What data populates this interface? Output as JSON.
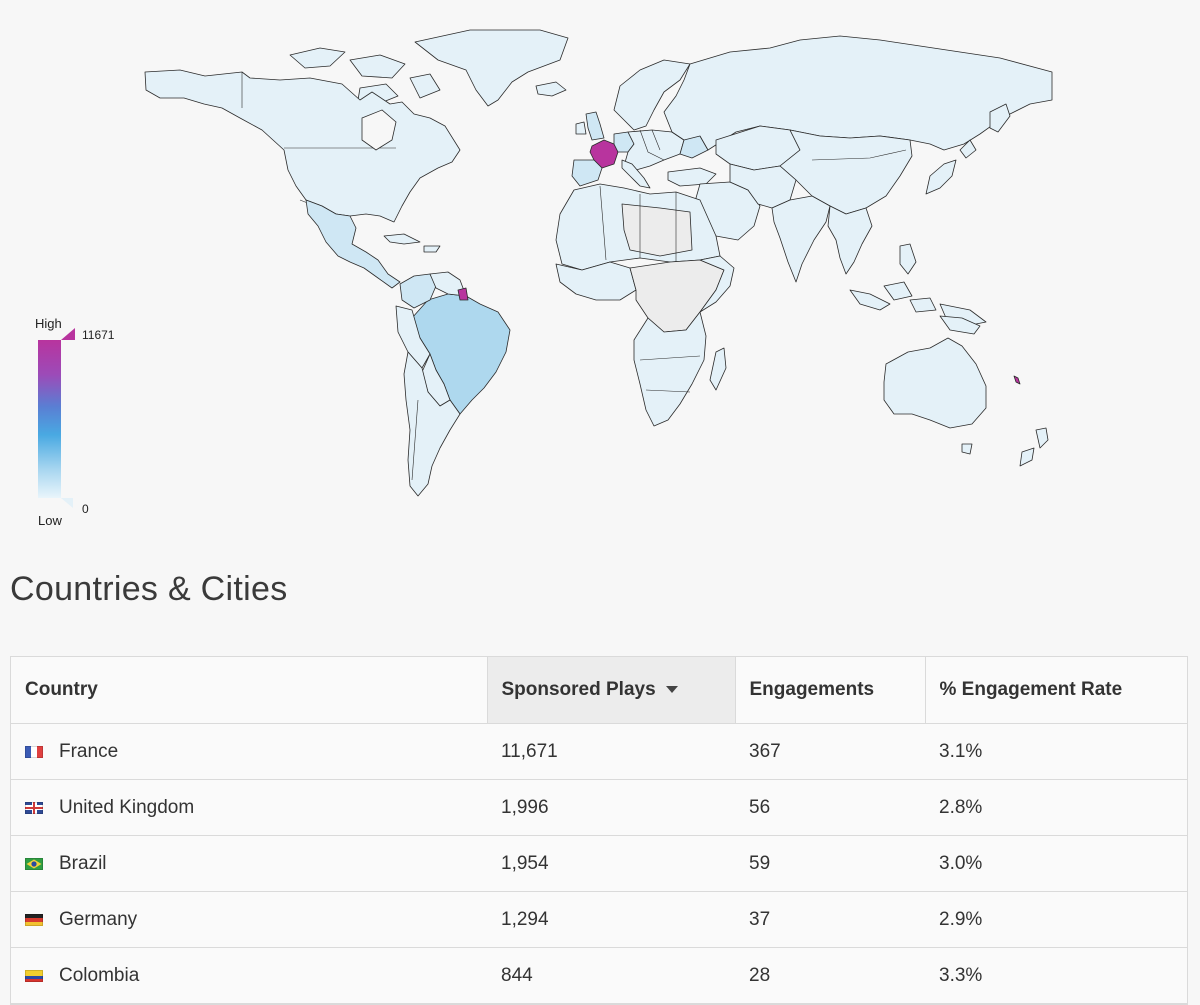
{
  "map": {
    "legend": {
      "high_label": "High",
      "low_label": "Low",
      "max_value": "11671",
      "min_value": "0"
    },
    "colors": {
      "high": "#b8349e",
      "mid": "#49a9e2",
      "low": "#e4f1f8",
      "no_data": "#ececec"
    },
    "highlighted_countries": [
      "France",
      "French Guiana"
    ]
  },
  "section": {
    "title": "Countries & Cities"
  },
  "table": {
    "columns": [
      "Country",
      "Sponsored Plays",
      "Engagements",
      "% Engagement Rate"
    ],
    "sorted_column": "Sponsored Plays",
    "rows": [
      {
        "flag": "france-flag-icon",
        "country": "France",
        "plays": "11,671",
        "engagements": "367",
        "rate": "3.1%"
      },
      {
        "flag": "uk-flag-icon",
        "country": "United Kingdom",
        "plays": "1,996",
        "engagements": "56",
        "rate": "2.8%"
      },
      {
        "flag": "brazil-flag-icon",
        "country": "Brazil",
        "plays": "1,954",
        "engagements": "59",
        "rate": "3.0%"
      },
      {
        "flag": "germany-flag-icon",
        "country": "Germany",
        "plays": "1,294",
        "engagements": "37",
        "rate": "2.9%"
      },
      {
        "flag": "colombia-flag-icon",
        "country": "Colombia",
        "plays": "844",
        "engagements": "28",
        "rate": "3.3%"
      }
    ]
  }
}
